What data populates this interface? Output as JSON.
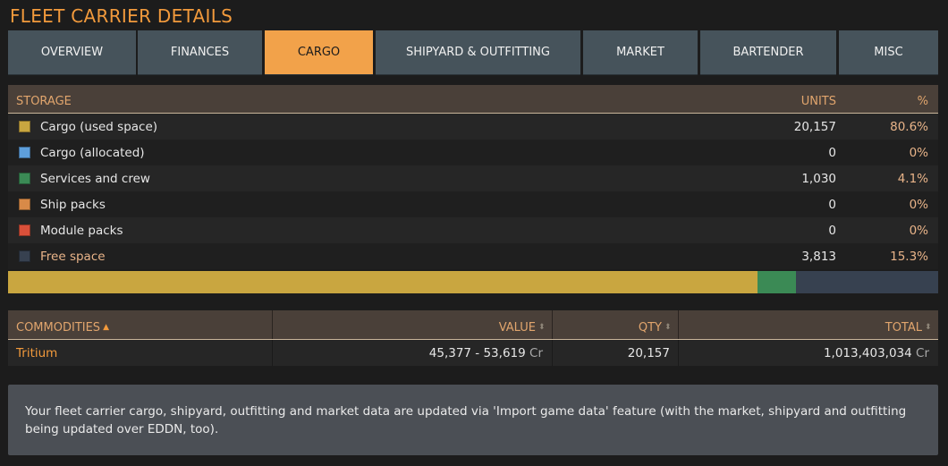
{
  "page": {
    "title": "FLEET CARRIER DETAILS"
  },
  "tabs": [
    {
      "label": "OVERVIEW",
      "active": false
    },
    {
      "label": "FINANCES",
      "active": false
    },
    {
      "label": "CARGO",
      "active": true
    },
    {
      "label": "SHIPYARD & OUTFITTING",
      "active": false
    },
    {
      "label": "MARKET",
      "active": false
    },
    {
      "label": "BARTENDER",
      "active": false
    },
    {
      "label": "MISC",
      "active": false
    }
  ],
  "storage": {
    "header": {
      "storage": "STORAGE",
      "units": "UNITS",
      "pct": "%"
    },
    "rows": [
      {
        "label": "Cargo (used space)",
        "units": "20,157",
        "pct": "80.6%",
        "color": "#c9a640"
      },
      {
        "label": "Cargo (allocated)",
        "units": "0",
        "pct": "0%",
        "color": "#5e9fdc"
      },
      {
        "label": "Services and crew",
        "units": "1,030",
        "pct": "4.1%",
        "color": "#3b8a55"
      },
      {
        "label": "Ship packs",
        "units": "0",
        "pct": "0%",
        "color": "#d88a48"
      },
      {
        "label": "Module packs",
        "units": "0",
        "pct": "0%",
        "color": "#d9503a"
      },
      {
        "label": "Free space",
        "units": "3,813",
        "pct": "15.3%",
        "color": "#374150"
      }
    ],
    "bar": [
      {
        "name": "cargo-used",
        "fraction": 0.806,
        "color": "#c9a640"
      },
      {
        "name": "services-crew",
        "fraction": 0.041,
        "color": "#3b8a55"
      },
      {
        "name": "free-space",
        "fraction": 0.153,
        "color": "#374150"
      }
    ]
  },
  "commodities": {
    "header": {
      "commodity": "COMMODITIES",
      "value": "VALUE",
      "qty": "QTY",
      "total": "TOTAL"
    },
    "rows": [
      {
        "name": "Tritium",
        "value": "45,377 - 53,619",
        "value_unit": "Cr",
        "qty": "20,157",
        "total": "1,013,403,034",
        "total_unit": "Cr"
      }
    ]
  },
  "note": {
    "text": "Your fleet carrier cargo, shipyard, outfitting and market data are updated via 'Import game data' feature (with the market, shipyard and outfitting being updated over EDDN, too)."
  },
  "icons": {
    "sort_asc": "caret-up-icon",
    "sort": "sort-icon"
  },
  "colors": {
    "accent": "#f29a3c",
    "tab_bg": "#46535b",
    "tab_active": "#f2a24a"
  }
}
